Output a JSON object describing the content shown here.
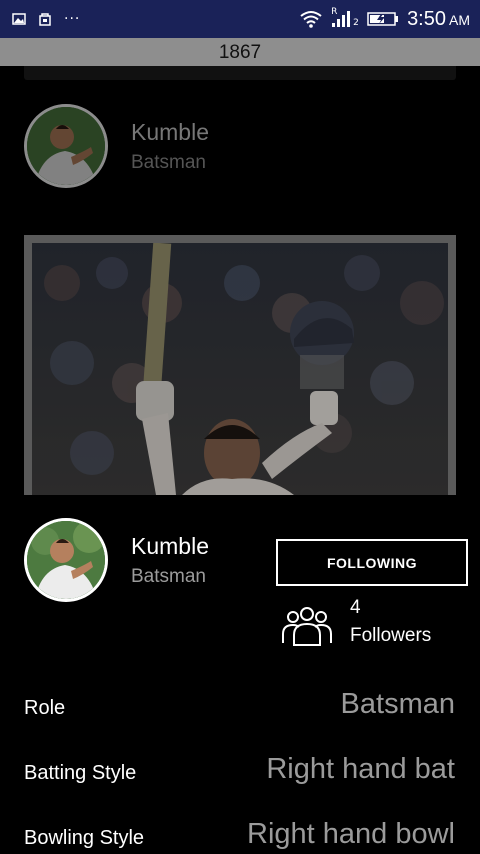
{
  "status_bar": {
    "left_icons": [
      "image-icon",
      "bag-icon",
      "more-dots-icon"
    ],
    "dots": "···",
    "right_icons": [
      "wifi-icon",
      "signal-icon",
      "battery-icon"
    ],
    "signal_roaming": "R",
    "signal_sim": "2",
    "time": "3:50",
    "ampm": "AM"
  },
  "top_bar": {
    "title": "1867"
  },
  "header_profile": {
    "name": "Kumble",
    "role": "Batsman"
  },
  "profile": {
    "name": "Kumble",
    "role": "Batsman",
    "follow_button": "FOLLOWING",
    "followers_count": "4",
    "followers_label": "Followers"
  },
  "details": [
    {
      "label": "Role",
      "value": "Batsman"
    },
    {
      "label": "Batting Style",
      "value": "Right hand bat"
    },
    {
      "label": "Bowling Style",
      "value": "Right hand bowl"
    }
  ],
  "colors": {
    "status_bar": "#1a2258",
    "background": "#000000",
    "muted_text": "#9b9b9b",
    "top_strip": "#8e8e8e"
  }
}
